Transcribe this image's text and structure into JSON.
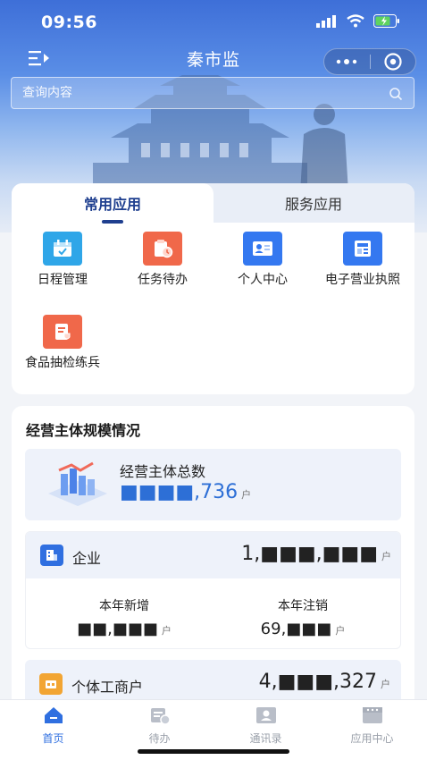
{
  "status_bar": {
    "time": "09:56"
  },
  "nav": {
    "title": "秦市监"
  },
  "search": {
    "placeholder": "查询内容"
  },
  "app_tabs": [
    {
      "label": "常用应用",
      "active": true
    },
    {
      "label": "服务应用",
      "active": false
    }
  ],
  "apps": [
    {
      "label": "日程管理",
      "icon": "calendar-icon",
      "color": "#2fa6e8"
    },
    {
      "label": "任务待办",
      "icon": "task-clock-icon",
      "color": "#f0684a"
    },
    {
      "label": "个人中心",
      "icon": "contact-card-icon",
      "color": "#3478f0"
    },
    {
      "label": "电子营业执照",
      "icon": "license-icon",
      "color": "#3478f0"
    },
    {
      "label": "食品抽检练兵",
      "icon": "food-check-icon",
      "color": "#f0684a"
    }
  ],
  "stats": {
    "title": "经营主体规模情况",
    "total": {
      "label": "经营主体总数",
      "value": "■■■■,736",
      "unit": "户"
    },
    "enterprise": {
      "label": "企业",
      "value": "1,■■■,■■■",
      "unit": "户",
      "new_label": "本年新增",
      "new_value": "■■,■■■",
      "new_unit": "户",
      "cancel_label": "本年注销",
      "cancel_value": "69,■■■",
      "cancel_unit": "户"
    },
    "individual": {
      "label": "个体工商户",
      "value": "4,■■■,327",
      "unit": "户"
    }
  },
  "tabbar": [
    {
      "label": "首页",
      "icon": "home-icon",
      "active": true
    },
    {
      "label": "待办",
      "icon": "todo-icon",
      "active": false
    },
    {
      "label": "通讯录",
      "icon": "contacts-icon",
      "active": false
    },
    {
      "label": "应用中心",
      "icon": "app-center-icon",
      "active": false
    }
  ],
  "colors": {
    "primary": "#2f6fe0",
    "tab_active": "#1f3f8f",
    "accent_orange": "#f0684a"
  }
}
